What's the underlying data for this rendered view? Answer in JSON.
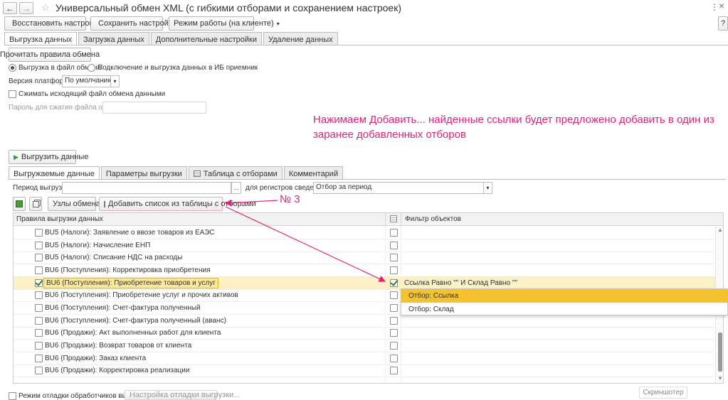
{
  "window": {
    "title": "Универсальный обмен XML (с гибкими отборами и сохранением настроек)",
    "help_label": "?",
    "more_label": "⋮",
    "close_label": "×"
  },
  "toolbar": {
    "restore_label": "Восстановить настройки",
    "save_label": "Сохранить настройки",
    "mode_label": "Режим работы (на клиенте)"
  },
  "main_tabs": [
    {
      "label": "Выгрузка данных"
    },
    {
      "label": "Загрузка данных"
    },
    {
      "label": "Дополнительные настройки"
    },
    {
      "label": "Удаление данных"
    }
  ],
  "export": {
    "read_rules_label": "Прочитать правила обмена",
    "radio_file_label": "Выгрузка в файл обмена",
    "radio_ib_label": "Подключение и выгрузка данных в ИБ приемник",
    "platform_label": "Версия платформы:",
    "platform_value": "По умолчанию",
    "compress_label": "Сжимать исходящий файл обмена данными",
    "password_label": "Пароль для сжатия файла обмена:",
    "run_label": "Выгрузить данные"
  },
  "annotation": {
    "text_line1": "Нажимаем Добавить... найденные ссылки будет предложено добавить в один из",
    "text_line2": "заранее добавленных отборов",
    "num_label": "№ 3",
    "color": "#e0217a"
  },
  "inner_tabs": [
    {
      "label": "Выгружаемые данные"
    },
    {
      "label": "Параметры выгрузки"
    },
    {
      "label": "Таблица с отборами"
    },
    {
      "label": "Комментарий"
    }
  ],
  "period": {
    "label": "Период выгрузки:",
    "dots_label": "...",
    "registers_label": "для регистров сведений:",
    "registers_value": "Отбор за период"
  },
  "grid_toolbar": {
    "nodes_label": "Узлы обмена",
    "add_list_label": "Добавить список из таблицы с отборами"
  },
  "grid": {
    "col_rules": "Правила выгрузки данных",
    "col_filter": "Фильтр объектов",
    "rows": [
      {
        "label": "BU5 (Налоги): Заявление о ввозе товаров из ЕАЭС",
        "checked": false,
        "filter": ""
      },
      {
        "label": "BU5 (Налоги): Начисление ЕНП",
        "checked": false,
        "filter": ""
      },
      {
        "label": "BU5 (Налоги): Списание НДС на расходы",
        "checked": false,
        "filter": ""
      },
      {
        "label": "BU6 (Поступления): Корректировка приобретения",
        "checked": false,
        "filter": ""
      },
      {
        "label": "BU6 (Поступления): Приобретение товаров и услуг",
        "checked": true,
        "filter": "Ссылка Равно \"\" И Склад Равно \"\""
      },
      {
        "label": "BU6 (Поступления): Приобретение услуг и прочих активов",
        "checked": false,
        "filter": ""
      },
      {
        "label": "BU6 (Поступления): Счет-фактура полученный",
        "checked": false,
        "filter": ""
      },
      {
        "label": "BU6 (Поступления): Счет-фактура полученный (аванс)",
        "checked": false,
        "filter": ""
      },
      {
        "label": "BU6 (Продажи): Акт выполненных работ для клиента",
        "checked": false,
        "filter": ""
      },
      {
        "label": "BU6 (Продажи): Возврат товаров от клиента",
        "checked": false,
        "filter": ""
      },
      {
        "label": "BU6 (Продажи): Заказ клиента",
        "checked": false,
        "filter": ""
      },
      {
        "label": "BU6 (Продажи): Корректировка реализации",
        "checked": false,
        "filter": ""
      }
    ]
  },
  "popup": {
    "items": [
      {
        "label": "Отбор: Ссылка"
      },
      {
        "label": "Отбор: Склад"
      }
    ]
  },
  "footer": {
    "debug_label": "Режим отладки обработчиков выгрузки",
    "debug_settings_label": "Настройка отладки выгрузки...",
    "screenshot_label": "Скриншотер"
  }
}
